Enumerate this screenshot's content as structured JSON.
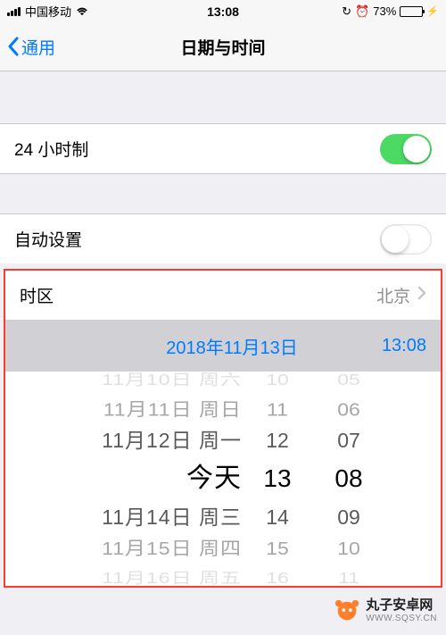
{
  "status": {
    "carrier": "中国移动",
    "time": "13:08",
    "battery_pct": "73%"
  },
  "nav": {
    "back_label": "通用",
    "title": "日期与时间"
  },
  "settings": {
    "twenty_four_hour": {
      "label": "24 小时制",
      "enabled": true
    },
    "auto_set": {
      "label": "自动设置",
      "enabled": false
    },
    "timezone": {
      "label": "时区",
      "value": "北京"
    }
  },
  "datetime_display": {
    "date": "2018年11月13日",
    "time": "13:08"
  },
  "picker": {
    "date": [
      "11月10日 周六",
      "11月11日 周日",
      "11月12日 周一",
      "今天",
      "11月14日 周三",
      "11月15日 周四",
      "11月16日 周五"
    ],
    "hour": [
      "10",
      "11",
      "12",
      "13",
      "14",
      "15",
      "16"
    ],
    "minute": [
      "05",
      "06",
      "07",
      "08",
      "09",
      "10",
      "11"
    ]
  },
  "watermark": {
    "name": "丸子安卓网",
    "url": "WWW.SQSY.CN"
  }
}
